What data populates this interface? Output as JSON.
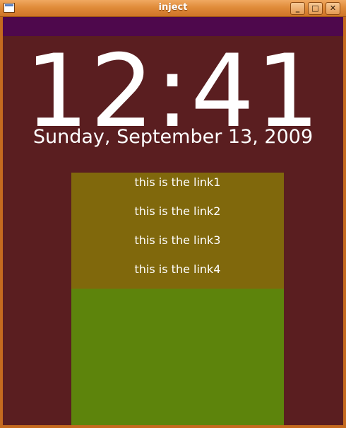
{
  "window": {
    "title": "inject",
    "minimize_label": "_",
    "maximize_label": "□",
    "close_label": "✕"
  },
  "clock": {
    "time": "12:41",
    "date": "Sunday, September 13, 2009"
  },
  "links": [
    {
      "label": "this is the link1"
    },
    {
      "label": "this is the link2"
    },
    {
      "label": "this is the link3"
    },
    {
      "label": "this is the link4"
    }
  ],
  "colors": {
    "background": "#5a1e20",
    "top_bar": "#4e084c",
    "links_panel": "#80680c",
    "green_panel": "#5d840c",
    "titlebar": "#e08c3a",
    "text": "#ffffff"
  }
}
